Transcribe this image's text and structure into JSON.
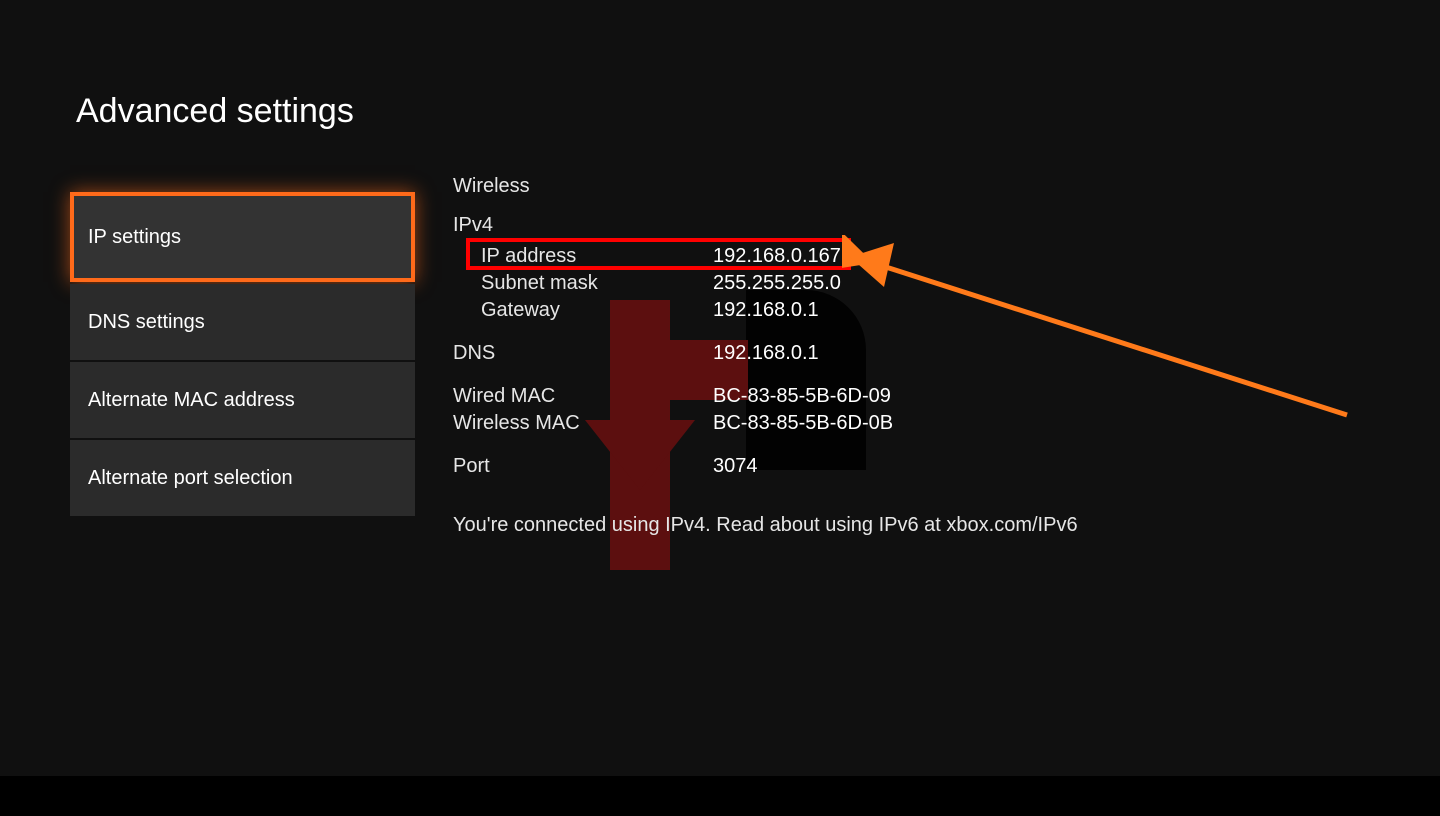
{
  "page": {
    "title": "Advanced settings"
  },
  "sidebar": {
    "items": [
      {
        "label": "IP settings",
        "selected": true
      },
      {
        "label": "DNS settings",
        "selected": false
      },
      {
        "label": "Alternate MAC address",
        "selected": false
      },
      {
        "label": "Alternate port selection",
        "selected": false
      }
    ]
  },
  "details": {
    "connection_type": "Wireless",
    "ipv4": {
      "heading": "IPv4",
      "ip_address_label": "IP address",
      "ip_address_value": "192.168.0.167",
      "subnet_mask_label": "Subnet mask",
      "subnet_mask_value": "255.255.255.0",
      "gateway_label": "Gateway",
      "gateway_value": "192.168.0.1"
    },
    "dns": {
      "label": "DNS",
      "value": "192.168.0.1"
    },
    "wired_mac": {
      "label": "Wired MAC",
      "value": "BC-83-85-5B-6D-09"
    },
    "wireless_mac": {
      "label": "Wireless MAC",
      "value": "BC-83-85-5B-6D-0B"
    },
    "port": {
      "label": "Port",
      "value": "3074"
    },
    "footer": "You're connected using IPv4. Read about using IPv6 at xbox.com/IPv6"
  },
  "annotations": {
    "highlight": "ip-address-row",
    "arrow_color": "#ff7a1a",
    "highlight_color": "#ff0000"
  }
}
